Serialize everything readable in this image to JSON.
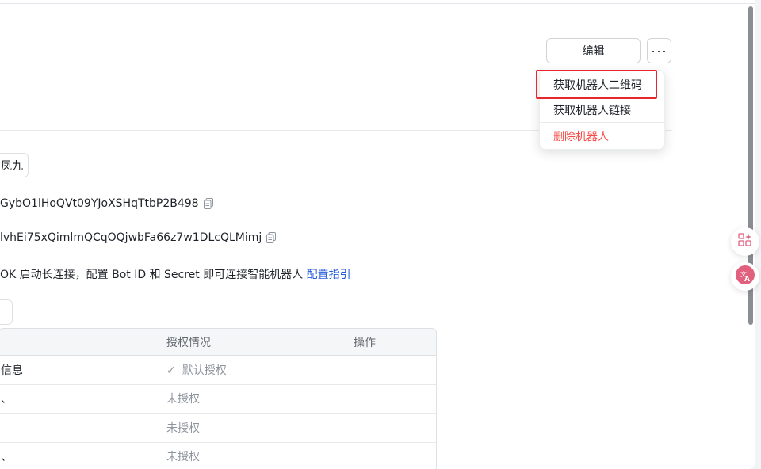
{
  "header": {
    "edit_label": "编辑",
    "more_label": "···"
  },
  "dropdown": {
    "items": [
      {
        "label": "获取机器人二维码"
      },
      {
        "label": "获取机器人链接"
      },
      {
        "label": "删除机器人"
      }
    ]
  },
  "bot": {
    "name": "凤九",
    "bot_id": "GybO1lHoQVt09YJoXSHqTtbP2B498",
    "secret": "lvhEi75xQimlmQCqOQjwbFa66z7w1DLcQLMimj"
  },
  "sdk": {
    "text": "OK 启动长连接，配置 Bot ID 和 Secret 即可连接智能机器人 ",
    "link": "配置指引"
  },
  "permissions": {
    "headers": [
      "",
      "授权情况",
      "操作"
    ],
    "rows": [
      {
        "name": "信息",
        "status": "默认授权",
        "check": "✓"
      },
      {
        "name": "、",
        "status": "未授权"
      },
      {
        "name": "",
        "status": "未授权"
      },
      {
        "name": "、",
        "status": "未授权"
      }
    ]
  },
  "colors": {
    "accent": "#245bdb",
    "danger": "#f54a45",
    "highlight": "#e8262b"
  },
  "icons": {
    "copy": "copy-icon",
    "more": "more-icon",
    "apps": "apps-icon",
    "translate": "translate-icon"
  }
}
